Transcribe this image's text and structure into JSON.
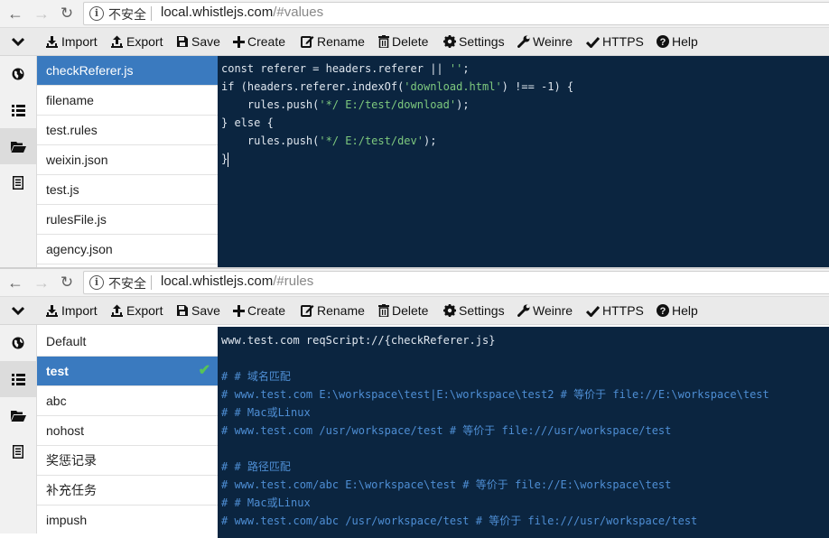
{
  "colors": {
    "editor_bg": "#0b2540",
    "selected_item": "#3a7abf",
    "string": "#7ec97e",
    "comment": "#4e8ed4",
    "check": "#57c457"
  },
  "toolbar": {
    "import": "Import",
    "export": "Export",
    "save": "Save",
    "create": "Create",
    "rename": "Rename",
    "delete": "Delete",
    "settings": "Settings",
    "weinre": "Weinre",
    "https": "HTTPS",
    "help": "Help"
  },
  "icons": [
    "arrow-left-icon",
    "arrow-right-icon",
    "reload-icon",
    "info-icon",
    "chevron-down-icon",
    "import-icon",
    "export-icon",
    "save-icon",
    "plus-icon",
    "edit-icon",
    "trash-icon",
    "gear-icon",
    "wrench-icon",
    "check-icon",
    "help-icon",
    "globe-icon",
    "list-icon",
    "folder-open-icon",
    "document-list-icon"
  ],
  "top": {
    "address": {
      "security": "不安全",
      "host": "local.whistlejs.com",
      "path": "/#values"
    },
    "files": [
      "checkReferer.js",
      "filename",
      "test.rules",
      "weixin.json",
      "test.js",
      "rulesFile.js",
      "agency.json"
    ],
    "selected": "checkReferer.js",
    "code": [
      [
        "const referer = headers.referer || ",
        "''",
        ";"
      ],
      [
        "if (headers.referer.indexOf(",
        "'download.html'",
        ") !== -1) {"
      ],
      [
        "    rules.push(",
        "'*/ E:/test/download'",
        ");"
      ],
      [
        "} else {",
        "",
        ""
      ],
      [
        "    rules.push(",
        "'*/ E:/test/dev'",
        ");"
      ],
      [
        "}",
        "",
        ""
      ]
    ]
  },
  "bottom": {
    "address": {
      "security": "不安全",
      "host": "local.whistlejs.com",
      "path": "/#rules"
    },
    "files": [
      "Default",
      "test",
      "abc",
      "nohost",
      "奖惩记录",
      "补充任务",
      "impush"
    ],
    "selected": "test",
    "rules": [
      {
        "text": "www.test.com reqScript://{checkReferer.js}",
        "comment": false
      },
      {
        "text": "",
        "comment": false
      },
      {
        "text": "# # 域名匹配",
        "comment": true
      },
      {
        "text": "# www.test.com E:\\workspace\\test|E:\\workspace\\test2 # 等价于 file://E:\\workspace\\test",
        "comment": true
      },
      {
        "text": "# # Mac或Linux",
        "comment": true
      },
      {
        "text": "# www.test.com /usr/workspace/test # 等价于 file:///usr/workspace/test",
        "comment": true
      },
      {
        "text": "",
        "comment": false
      },
      {
        "text": "# # 路径匹配",
        "comment": true
      },
      {
        "text": "# www.test.com/abc E:\\workspace\\test # 等价于 file://E:\\workspace\\test",
        "comment": true
      },
      {
        "text": "# # Mac或Linux",
        "comment": true
      },
      {
        "text": "# www.test.com/abc /usr/workspace/test # 等价于 file:///usr/workspace/test",
        "comment": true
      }
    ]
  }
}
